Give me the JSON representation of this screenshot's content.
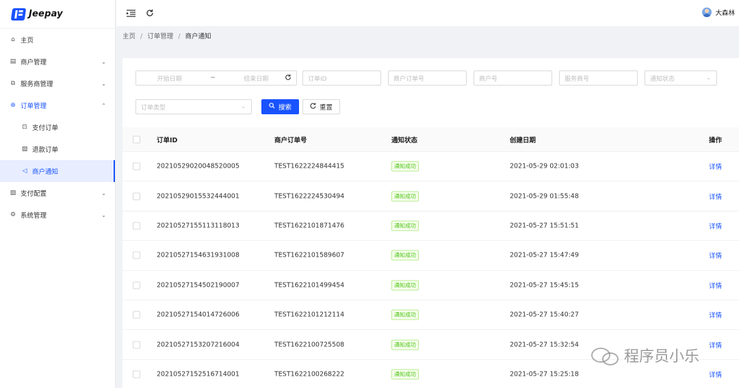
{
  "app": {
    "name": "Jeepay"
  },
  "topbar": {
    "username": "大森林"
  },
  "sidebar": {
    "items": [
      {
        "label": "主页",
        "icon": "home-icon",
        "glyph": "⌂"
      },
      {
        "label": "商户管理",
        "icon": "merchant-icon",
        "glyph": "▤",
        "arrow": "⌄"
      },
      {
        "label": "服务商管理",
        "icon": "provider-icon",
        "glyph": "⧉",
        "arrow": "⌄"
      },
      {
        "label": "订单管理",
        "icon": "order-icon",
        "glyph": "⊛",
        "arrow": "⌃"
      },
      {
        "label": "支付订单",
        "icon": "pay-order-icon",
        "glyph": "⊡"
      },
      {
        "label": "退款订单",
        "icon": "refund-order-icon",
        "glyph": "▧"
      },
      {
        "label": "商户通知",
        "icon": "notification-icon",
        "glyph": "◁"
      },
      {
        "label": "支付配置",
        "icon": "pay-config-icon",
        "glyph": "▨",
        "arrow": "⌄"
      },
      {
        "label": "系统管理",
        "icon": "settings-icon",
        "glyph": "⚙",
        "arrow": "⌄"
      }
    ]
  },
  "breadcrumb": {
    "home": "主页",
    "sep": "/",
    "section": "订单管理",
    "current": "商户通知"
  },
  "filters": {
    "start_date": "开始日期",
    "tilde": "~",
    "end_date": "结束日期",
    "order_id": "订单ID",
    "mch_order_no": "商户订单号",
    "mch_no": "商户号",
    "isv_no": "服务商号",
    "notify_state": "通知状态",
    "order_type": "订单类型"
  },
  "buttons": {
    "search": "搜索",
    "reset": "重置"
  },
  "table": {
    "headers": {
      "order_id": "订单ID",
      "mch_order_no": "商户订单号",
      "state": "通知状态",
      "created": "创建日期",
      "action": "操作"
    },
    "rows": [
      {
        "order_id": "20210529020048520005",
        "mch_order_no": "TEST1622224844415",
        "state": "通知成功",
        "created": "2021-05-29 02:01:03",
        "action": "详情"
      },
      {
        "order_id": "20210529015532444001",
        "mch_order_no": "TEST1622224530494",
        "state": "通知成功",
        "created": "2021-05-29 01:55:48",
        "action": "详情"
      },
      {
        "order_id": "20210527155113118013",
        "mch_order_no": "TEST1622101871476",
        "state": "通知成功",
        "created": "2021-05-27 15:51:51",
        "action": "详情"
      },
      {
        "order_id": "20210527154631931008",
        "mch_order_no": "TEST1622101589607",
        "state": "通知成功",
        "created": "2021-05-27 15:47:49",
        "action": "详情"
      },
      {
        "order_id": "20210527154502190007",
        "mch_order_no": "TEST1622101499454",
        "state": "通知成功",
        "created": "2021-05-27 15:45:15",
        "action": "详情"
      },
      {
        "order_id": "20210527154014726006",
        "mch_order_no": "TEST1622101212114",
        "state": "通知成功",
        "created": "2021-05-27 15:40:27",
        "action": "详情"
      },
      {
        "order_id": "20210527153207216004",
        "mch_order_no": "TEST1622100725508",
        "state": "通知成功",
        "created": "2021-05-27 15:32:54",
        "action": "详情"
      },
      {
        "order_id": "20210527152516714001",
        "mch_order_no": "TEST1622100268222",
        "state": "通知成功",
        "created": "2021-05-27 15:25:18",
        "action": "详情"
      }
    ]
  },
  "watermark": {
    "text": "程序员小乐"
  }
}
